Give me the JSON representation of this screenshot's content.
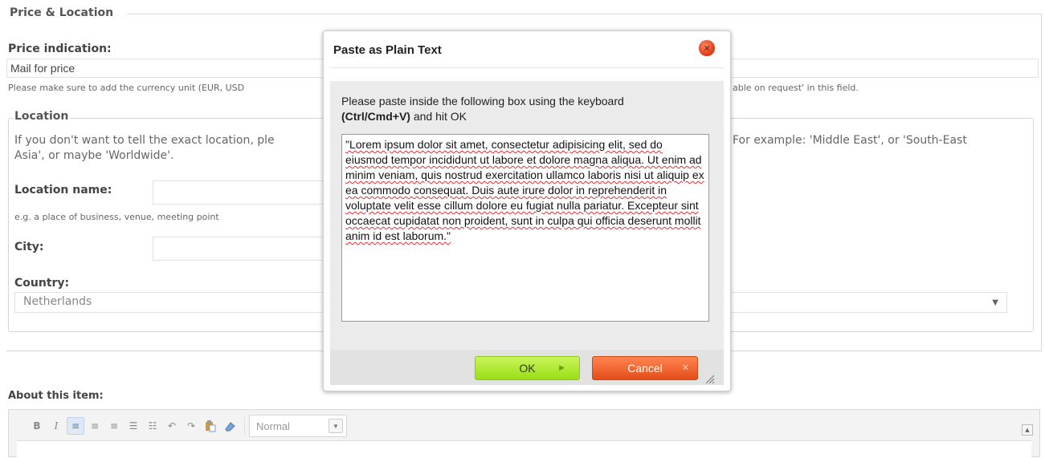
{
  "form": {
    "section_title": "Price & Location",
    "price_label": "Price indication:",
    "price_value": "Mail for price",
    "price_hint_left": "Please make sure to add the currency unit (EUR, USD",
    "price_hint_right": "able on request' in this field.",
    "location_legend": "Location",
    "location_desc_left": "If you don't want to tell the exact location, ple",
    "location_desc_left_2": "Asia', or maybe 'Worldwide'.",
    "location_desc_right": "For example: 'Middle East', or 'South-East",
    "location_name_label": "Location name:",
    "location_name_hint": "e.g. a place of business, venue, meeting point",
    "city_label": "City:",
    "country_label": "Country:",
    "country_value": "Netherlands"
  },
  "about": {
    "label": "About this item:",
    "format_value": "Normal",
    "toolbar_icons": [
      "bold-icon",
      "italic-icon",
      "align-left-icon",
      "align-center-icon",
      "align-right-icon",
      "bullet-list-icon",
      "numbered-list-icon",
      "undo-icon",
      "redo-icon",
      "paste-icon",
      "eraser-icon"
    ]
  },
  "dialog": {
    "title": "Paste as Plain Text",
    "instruction_pre": "Please paste inside the following box using the keyboard",
    "instruction_keys": "(Ctrl/Cmd+V)",
    "instruction_post": " and hit OK",
    "paste_text": "\"Lorem ipsum dolor sit amet, consectetur adipisicing elit, sed do eiusmod tempor incididunt ut labore et dolore magna aliqua. Ut enim ad minim veniam, quis nostrud exercitation ullamco laboris nisi ut aliquip ex ea commodo consequat. Duis aute irure dolor in reprehenderit in voluptate velit esse cillum dolore eu fugiat nulla pariatur. Excepteur sint occaecat cupidatat non proident, sunt in culpa qui officia deserunt mollit anim id est laborum.\"",
    "ok_label": "OK",
    "cancel_label": "Cancel"
  },
  "colors": {
    "ok_button": "#9ade17",
    "cancel_button": "#e44d18",
    "close_button": "#e2401a"
  }
}
